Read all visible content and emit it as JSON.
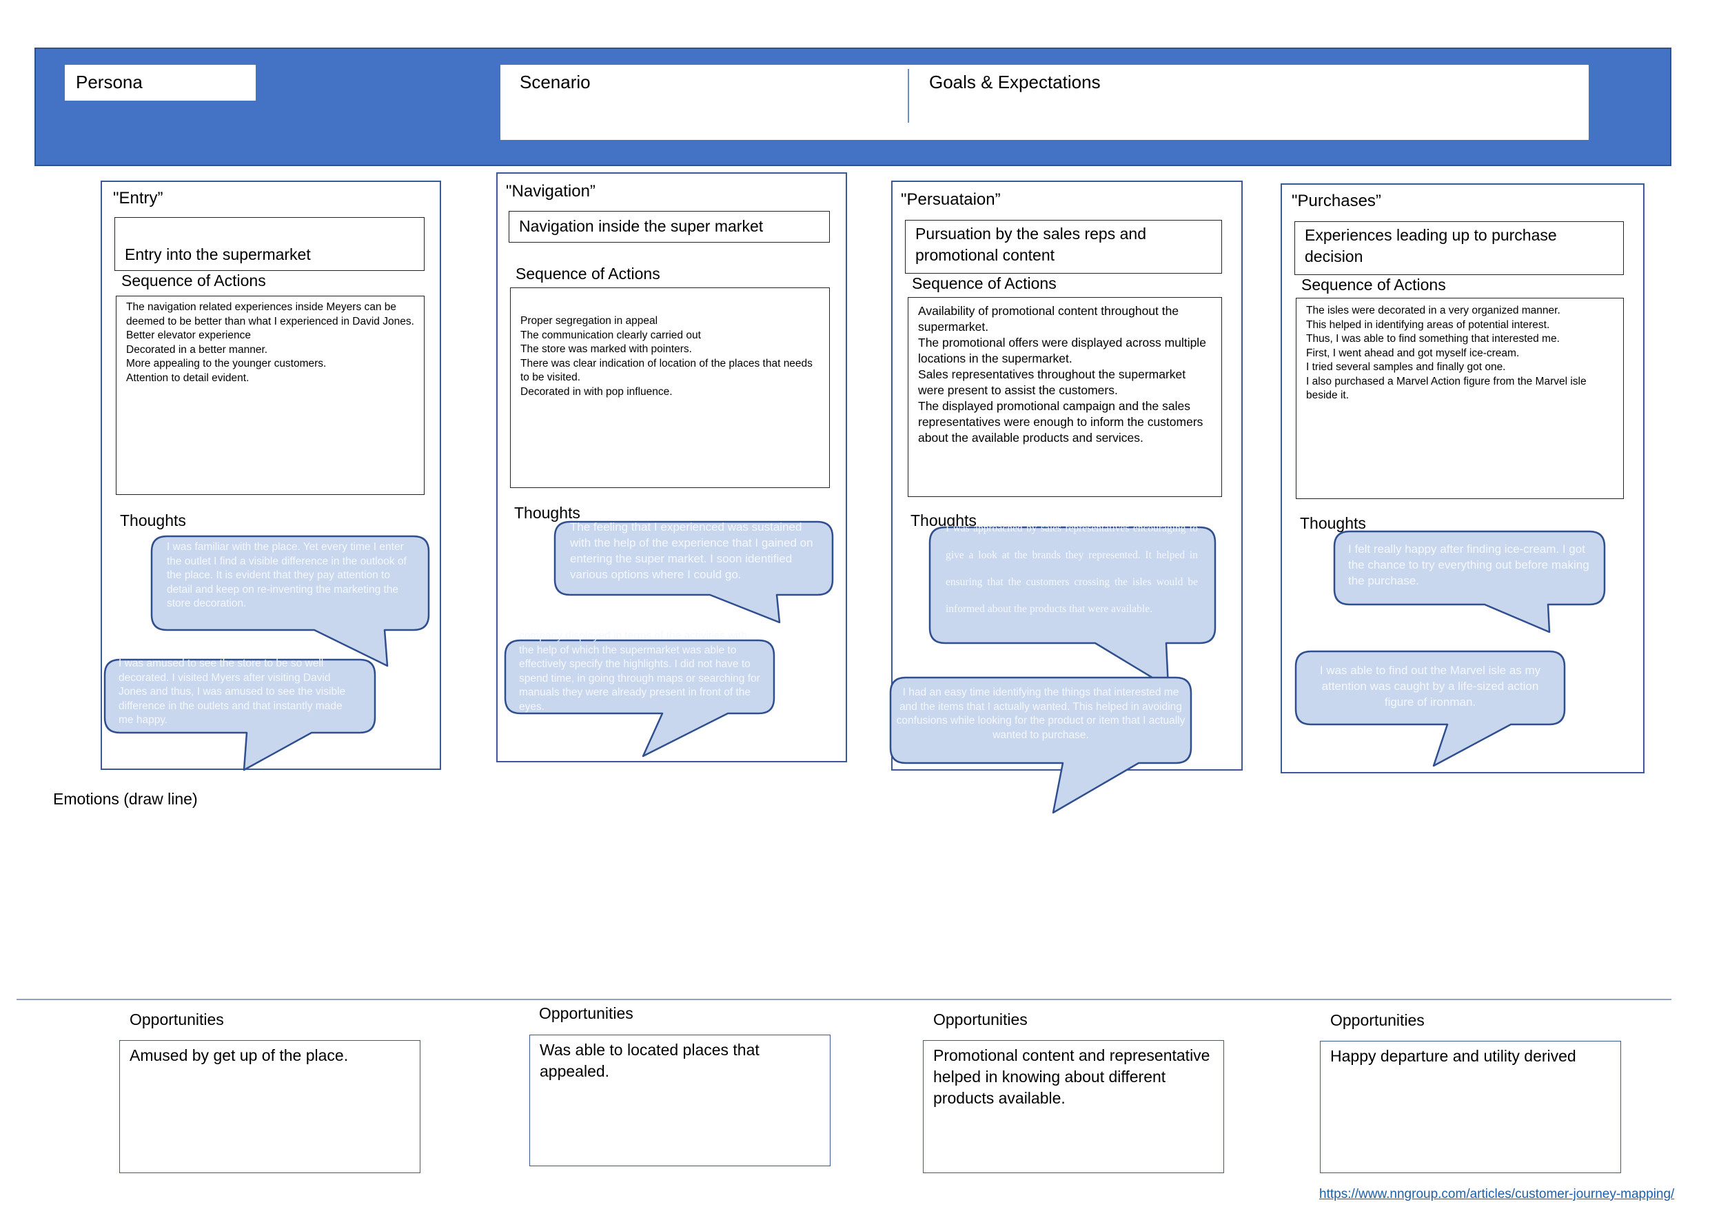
{
  "header": {
    "persona_label": "Persona",
    "scenario_label": "Scenario",
    "goals_label": "Goals & Expectations"
  },
  "stages": [
    {
      "title": "\"Entry”",
      "description": "Entry into the supermarket",
      "sequence_label": "Sequence of Actions",
      "sequence_lines": [
        "The navigation related experiences inside Meyers can be deemed to be better than what I experienced in David Jones.",
        "Better elevator experience",
        "Decorated in a better manner.",
        "More appealing to the younger customers.",
        "Attention to detail evident."
      ],
      "thoughts_label": "Thoughts",
      "thoughts": [
        "I was familiar with the place. Yet every time I enter the outlet I find a visible difference in the outlook of the place. It is evident that they pay attention to detail and keep on re-inventing the marketing the store decoration.",
        "I was amused to see the store to be so well decorated. I visited Myers after visiting David Jones and thus, I was amused to see the visible difference in the outlets and that instantly made me happy."
      ],
      "opportunities_label": "Opportunities",
      "opportunity": "Amused by get up of the place."
    },
    {
      "title": "\"Navigation”",
      "description": "Navigation inside the super market",
      "sequence_label": "Sequence of Actions",
      "sequence_lines": [
        "Proper segregation in appeal",
        "The communication clearly carried out",
        "The store was marked with pointers.",
        "There was clear indication of location of the places that needs to be visited.",
        "Decorated in with pop influence."
      ],
      "thoughts_label": "Thoughts",
      "thoughts": [
        "The feeling that I experienced was sustained with the help of the experience that I gained on entering the super market. I soon identified various options where I could go.",
        "company displayed in terms of the activities with the help of which the supermarket was able to effectively specify the highlights. I did not have to spend time, in going through maps or searching for manuals they were already present in front of the eyes."
      ],
      "opportunities_label": "Opportunities",
      "opportunity": "Was able to located places that appealed."
    },
    {
      "title": "\"Persuataion”",
      "description": "Pursuation by the sales reps and promotional content",
      "sequence_label": "Sequence of Actions",
      "sequence_lines": [
        "Availability of promotional content throughout the supermarket.",
        "The promotional offers were displayed across multiple locations in the supermarket.",
        "Sales representatives throughout the supermarket were present to assist the customers.",
        "The displayed promotional campaign and the sales representatives were enough to inform the customers about the available products and services."
      ],
      "thoughts_label": "Thoughts",
      "thoughts": [
        "I was approached by sales representatives encouraging to give a look at the brands they represented. It helped in ensuring that the customers crossing the isles would be informed about the products that were available.",
        "I had an easy time identifying the things that interested me and the items that I actually wanted. This helped in avoiding confusions while looking for the product or item that I actually wanted to purchase."
      ],
      "opportunities_label": "Opportunities",
      "opportunity": "Promotional content and representative helped in knowing about different products available."
    },
    {
      "title": "\"Purchases”",
      "description": "Experiences leading up to purchase decision",
      "sequence_label": "Sequence of Actions",
      "sequence_lines": [
        "The isles were decorated in a very organized manner.",
        "This helped in identifying areas of potential interest.",
        "Thus, I was able to find something that interested me.",
        "First, I went ahead and got myself ice-cream.",
        "I tried several samples and finally got one.",
        "I also purchased a Marvel Action figure from the Marvel isle beside it."
      ],
      "thoughts_label": "Thoughts",
      "thoughts": [
        "I felt really happy after finding ice-cream. I got the chance to try everything out before making the purchase.",
        "I was able to find out the Marvel isle as my attention was caught by a life-sized action figure of ironman."
      ],
      "opportunities_label": "Opportunities",
      "opportunity": "Happy departure and utility derived"
    }
  ],
  "emotions_label": "Emotions (draw line)",
  "reference_link": "https://www.nngroup.com/articles/customer-journey-mapping/",
  "colors": {
    "header_band": "#4472c4",
    "frame_border": "#3b5998",
    "bubble_fill": "#c9d7ee",
    "bubble_stroke": "#2f4f8f",
    "bubble_text": "#f4f7fc",
    "link": "#1f5fa8"
  }
}
